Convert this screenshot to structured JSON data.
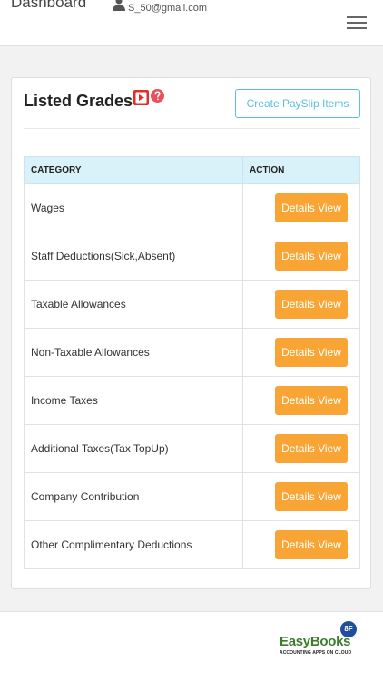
{
  "header": {
    "title": "Dashboard",
    "user_email": "S_50@gmail.com"
  },
  "card": {
    "title": "Listed Grades",
    "create_button": "Create PaySlip Items"
  },
  "table": {
    "columns": [
      "CATEGORY",
      "ACTION"
    ],
    "rows": [
      {
        "category": "Wages",
        "action": "Details View"
      },
      {
        "category": "Staff Deductions(Sick,Absent)",
        "action": "Details View"
      },
      {
        "category": "Taxable Allowances",
        "action": "Details View"
      },
      {
        "category": "Non-Taxable Allowances",
        "action": "Details View"
      },
      {
        "category": "Income Taxes",
        "action": "Details View"
      },
      {
        "category": "Additional Taxes(Tax TopUp)",
        "action": "Details View"
      },
      {
        "category": "Company Contribution",
        "action": "Details View"
      },
      {
        "category": "Other Complimentary Deductions",
        "action": "Details View"
      }
    ]
  },
  "footer": {
    "logo_text": "EasyBooks",
    "logo_badge": "8F",
    "logo_tagline": "ACCOUNTING APPS ON CLOUD"
  },
  "colors": {
    "accent_orange": "#f9a535",
    "accent_cyan": "#5bc0de",
    "header_row_bg": "#d9f1f8",
    "youtube_red": "#e52d27",
    "help_red": "#e8505b"
  },
  "icons": {
    "user": "user-icon",
    "menu": "hamburger-menu-icon",
    "video": "youtube-icon",
    "help": "help-icon"
  }
}
